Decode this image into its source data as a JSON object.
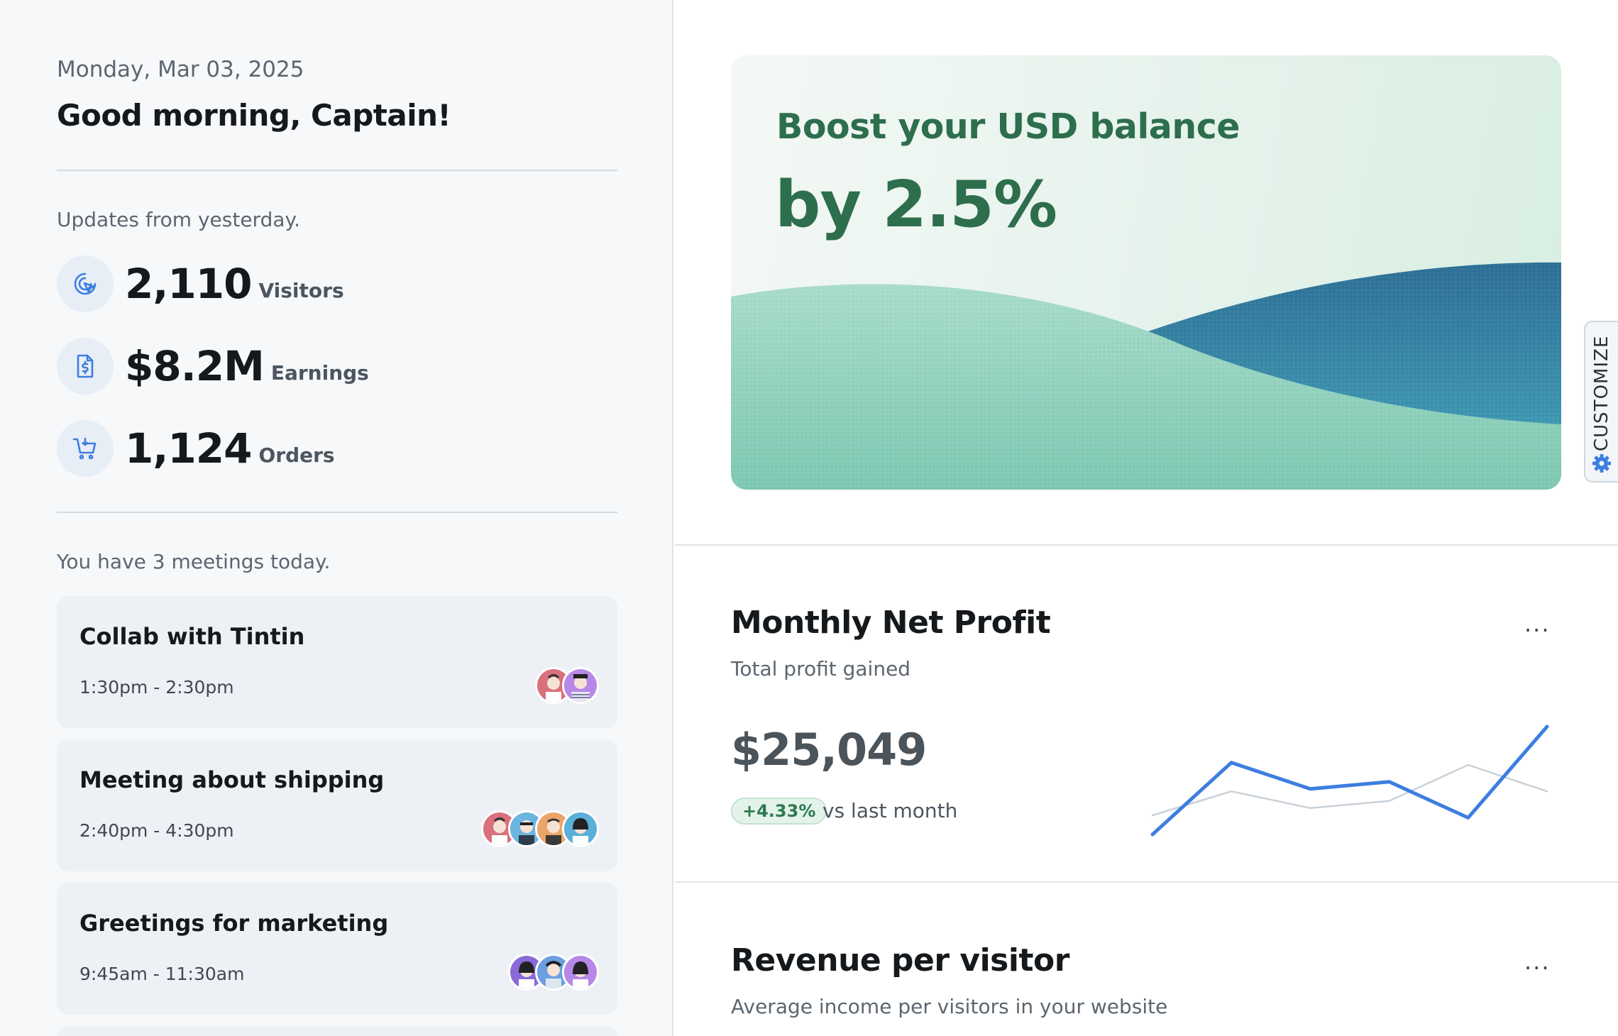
{
  "header": {
    "date": "Monday, Mar 03, 2025",
    "greeting": "Good morning,  Captain!"
  },
  "updates": {
    "title": "Updates from yesterday.",
    "stats": [
      {
        "value": "2,110",
        "label": "Visitors",
        "icon": "cursor-click-icon"
      },
      {
        "value": "$8.2M",
        "label": "Earnings",
        "icon": "dollar-document-icon"
      },
      {
        "value": "1,124",
        "label": "Orders",
        "icon": "cart-icon"
      }
    ]
  },
  "meetings": {
    "title": "You have 3 meetings today.",
    "items": [
      {
        "title": "Collab with Tintin",
        "time": "1:30pm - 2:30pm"
      },
      {
        "title": "Meeting about shipping",
        "time": "2:40pm - 4:30pm"
      },
      {
        "title": "Greetings for marketing",
        "time": "9:45am - 11:30am"
      }
    ]
  },
  "banner": {
    "line1": "Boost your USD balance",
    "line2": "by 2.5%"
  },
  "customize": {
    "label": "CUSTOMIZE",
    "icon": "gear-icon"
  },
  "profit_card": {
    "title": "Monthly Net Profit",
    "subtitle": "Total profit gained",
    "value": "$25,049",
    "change": "+4.33%",
    "change_text": "vs last month",
    "menu_label": "...",
    "colors": {
      "current": "#3d7ee0",
      "previous": "#c9d1d8",
      "positive": "#2c7a4f"
    }
  },
  "revenue_card": {
    "title": "Revenue per visitor",
    "subtitle": "Average income per visitors in your website",
    "menu_label": "..."
  },
  "chart_data": {
    "type": "line",
    "series": [
      {
        "values": [
          0,
          30,
          19,
          22,
          7,
          45
        ]
      },
      {
        "values": [
          8,
          18,
          11,
          14,
          29,
          18
        ]
      }
    ]
  }
}
